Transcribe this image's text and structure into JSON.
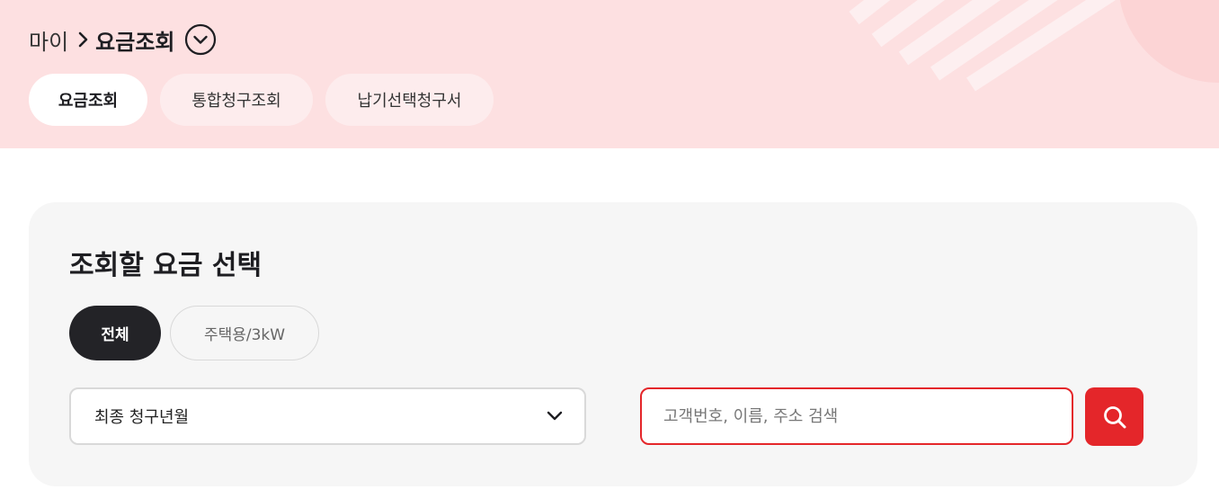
{
  "header": {
    "breadcrumb": {
      "home": "마이",
      "current": "요금조회"
    },
    "tabs": [
      {
        "label": "요금조회",
        "active": true
      },
      {
        "label": "통합청구조회",
        "active": false
      },
      {
        "label": "납기선택청구서",
        "active": false
      }
    ]
  },
  "panel": {
    "title": "조회할 요금 선택",
    "chips": [
      {
        "label": "전체",
        "active": true
      },
      {
        "label": "주택용/3kW",
        "active": false
      }
    ],
    "select": {
      "value": "최종 청구년월",
      "icon": "chevron-down-icon"
    },
    "search": {
      "placeholder": "고객번호, 이름, 주소 검색",
      "value": "",
      "icon": "search-icon"
    }
  },
  "colors": {
    "hero_background": "#fde0e1",
    "accent_red": "#e4262a",
    "active_chip": "#232327",
    "panel_background": "#f6f6f6"
  }
}
